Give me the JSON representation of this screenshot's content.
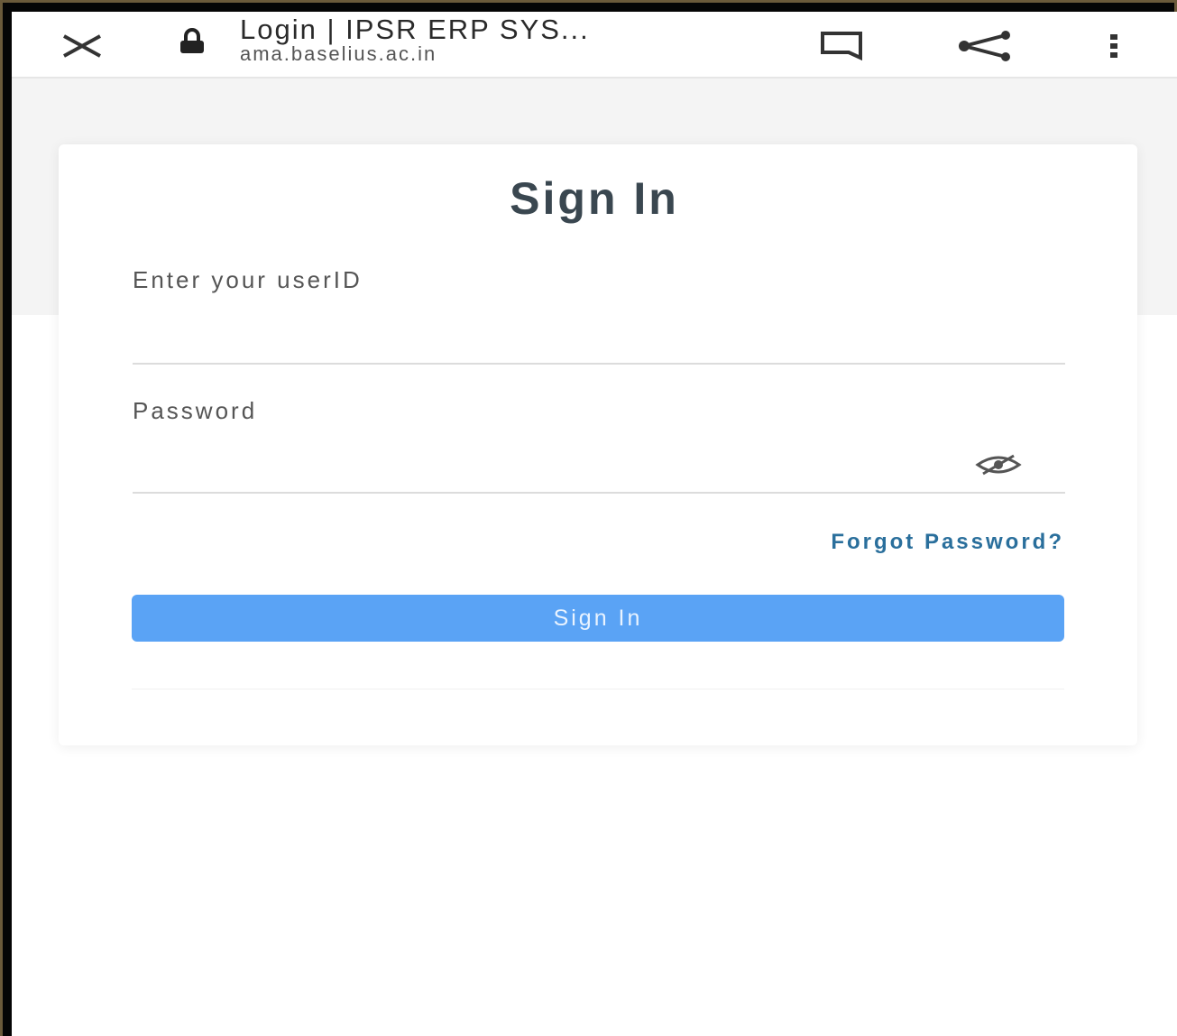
{
  "browser": {
    "tab_title": "Login | IPSR ERP SYS...",
    "url": "ama.baselius.ac.in",
    "icons": {
      "close": "close-icon",
      "lock": "lock-icon",
      "bookmark": "bookmark-icon",
      "share": "share-icon",
      "menu": "more-vertical-icon"
    }
  },
  "login": {
    "title": "Sign In",
    "userid_label": "Enter your userID",
    "userid_value": "",
    "password_label": "Password",
    "password_value": "",
    "forgot_password": "Forgot Password?",
    "submit_label": "Sign In",
    "eye_icon": "eye-slash-icon"
  },
  "colors": {
    "accent_button": "#5aa3f5",
    "link": "#2a6f9c",
    "title_text": "#3a4750"
  }
}
